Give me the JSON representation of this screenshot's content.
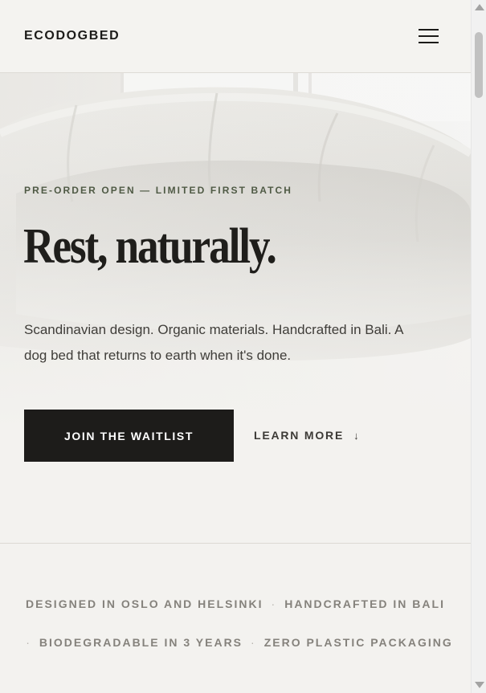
{
  "header": {
    "brand": "ECODOGBED",
    "menu_icon": "hamburger-menu-icon"
  },
  "hero": {
    "eyebrow": "PRE-ORDER OPEN — LIMITED FIRST BATCH",
    "headline": "Rest, naturally.",
    "subtitle": "Scandinavian design. Organic materials. Handcrafted in Bali. A dog bed that returns to earth when it's done.",
    "primary_cta": "JOIN THE WAITLIST",
    "secondary_cta": "LEARN MORE",
    "secondary_icon": "arrow-down-icon",
    "image": "linen-dog-bed-photo"
  },
  "features": {
    "row1": [
      "DESIGNED IN OSLO AND HELSINKI",
      "HANDCRAFTED IN BALI"
    ],
    "row2": [
      "BIODEGRADABLE IN 3 YEARS",
      "ZERO PLASTIC PACKAGING"
    ]
  },
  "colors": {
    "background": "#f3f2ef",
    "text": "#1c1b19",
    "eyebrow": "#4f5a45",
    "button": "#1d1c1a",
    "muted": "#85827c"
  }
}
